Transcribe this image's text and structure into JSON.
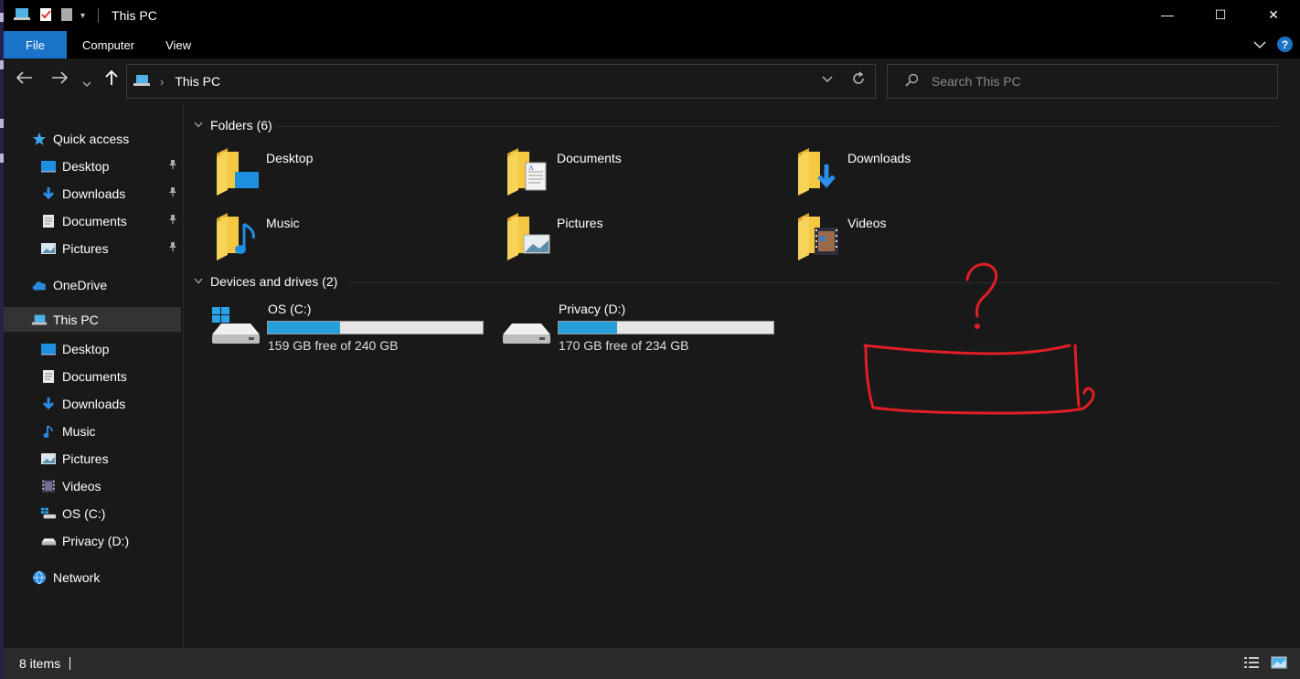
{
  "window": {
    "title": "This PC",
    "minimize_glyph": "—",
    "maximize_glyph": "☐",
    "close_glyph": "✕"
  },
  "ribbon": {
    "tabs": [
      "File",
      "Computer",
      "View"
    ],
    "help_glyph": "?"
  },
  "address": {
    "crumb": "This PC",
    "search_placeholder": "Search This PC"
  },
  "sidebar": {
    "items": [
      {
        "label": "Quick access",
        "icon": "star-icon",
        "indent": false,
        "pinned": false
      },
      {
        "label": "Desktop",
        "icon": "desktop-icon",
        "indent": true,
        "pinned": true
      },
      {
        "label": "Downloads",
        "icon": "download-icon",
        "indent": true,
        "pinned": true
      },
      {
        "label": "Documents",
        "icon": "document-icon",
        "indent": true,
        "pinned": true
      },
      {
        "label": "Pictures",
        "icon": "pictures-icon",
        "indent": true,
        "pinned": true
      },
      {
        "label": "OneDrive",
        "icon": "cloud-icon",
        "indent": false,
        "pinned": false
      },
      {
        "label": "This PC",
        "icon": "computer-icon",
        "indent": false,
        "pinned": false,
        "selected": true
      },
      {
        "label": "Desktop",
        "icon": "desktop-icon",
        "indent": true,
        "pinned": false
      },
      {
        "label": "Documents",
        "icon": "document-icon",
        "indent": true,
        "pinned": false
      },
      {
        "label": "Downloads",
        "icon": "download-icon",
        "indent": true,
        "pinned": false
      },
      {
        "label": "Music",
        "icon": "music-icon",
        "indent": true,
        "pinned": false
      },
      {
        "label": "Pictures",
        "icon": "pictures-icon",
        "indent": true,
        "pinned": false
      },
      {
        "label": "Videos",
        "icon": "videos-icon",
        "indent": true,
        "pinned": false
      },
      {
        "label": "OS (C:)",
        "icon": "windows-drive-icon",
        "indent": true,
        "pinned": false
      },
      {
        "label": "Privacy (D:)",
        "icon": "drive-icon",
        "indent": true,
        "pinned": false
      },
      {
        "label": "Network",
        "icon": "network-icon",
        "indent": false,
        "pinned": false
      }
    ]
  },
  "main": {
    "folders_header": "Folders (6)",
    "folders": [
      {
        "label": "Desktop",
        "overlay": "desktop"
      },
      {
        "label": "Documents",
        "overlay": "documents"
      },
      {
        "label": "Downloads",
        "overlay": "downloads"
      },
      {
        "label": "Music",
        "overlay": "music"
      },
      {
        "label": "Pictures",
        "overlay": "pictures"
      },
      {
        "label": "Videos",
        "overlay": "videos"
      }
    ],
    "drives_header": "Devices and drives (2)",
    "drives": [
      {
        "label": "OS (C:)",
        "free_text": "159 GB free of 240 GB",
        "used_fraction": 0.3375,
        "windows_logo": true
      },
      {
        "label": "Privacy (D:)",
        "free_text": "170 GB free of 234 GB",
        "used_fraction": 0.2735,
        "windows_logo": false
      }
    ]
  },
  "status": {
    "item_count": "8 items"
  },
  "colors": {
    "accent": "#1a73c7",
    "drive_fill": "#26a0da",
    "folder_yellow": "#f5c842",
    "annotation_red": "#e01e25"
  }
}
